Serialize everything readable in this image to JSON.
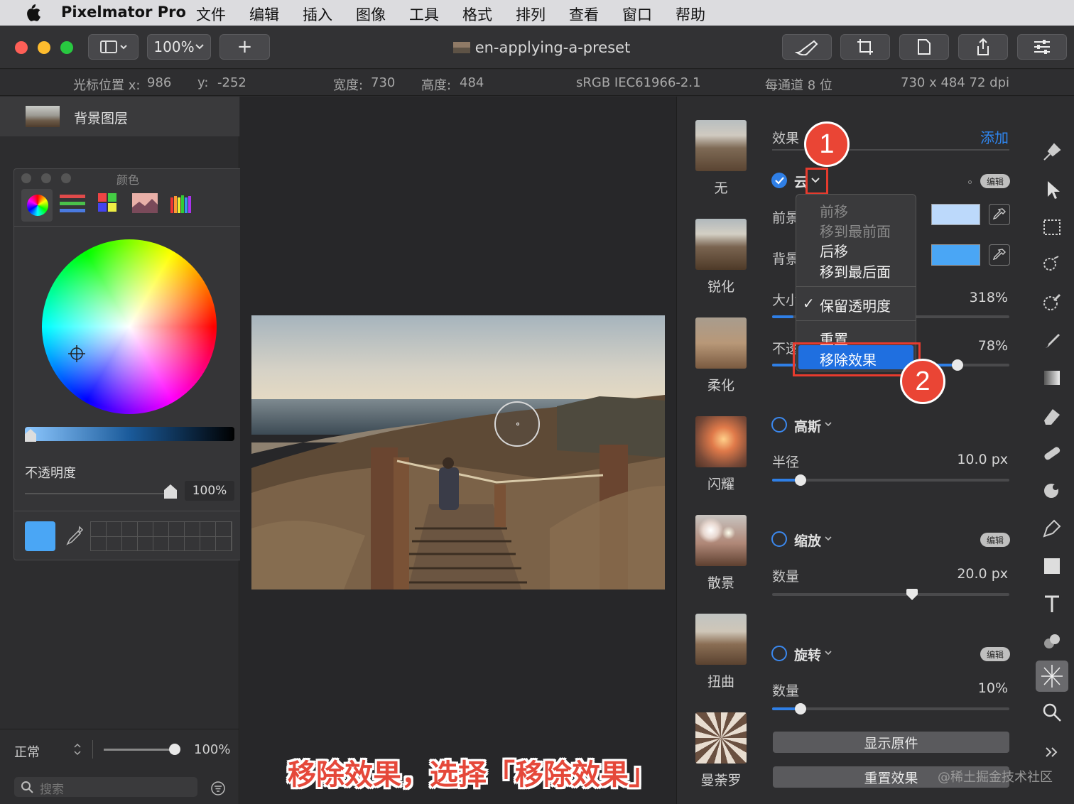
{
  "menubar": {
    "app_name": "Pixelmator Pro",
    "items": [
      "文件",
      "编辑",
      "插入",
      "图像",
      "工具",
      "格式",
      "排列",
      "查看",
      "窗口",
      "帮助"
    ]
  },
  "toolbar": {
    "zoom": "100%",
    "add_label": "+",
    "window_title": "en-applying-a-preset"
  },
  "infobar": {
    "cursor_x_label": "光标位置 x:",
    "cursor_x": "986",
    "cursor_y_label": "y:",
    "cursor_y": "-252",
    "width_label": "宽度:",
    "width": "730",
    "height_label": "高度:",
    "height": "484",
    "color_profile": "sRGB IEC61966-2.1",
    "bit_depth": "每通道 8 位",
    "dimensions": "730 x 484 72 dpi"
  },
  "layers": {
    "background_layer": "背景图层",
    "blend_mode": "正常",
    "opacity": "100%",
    "opacity_fraction": 1.0,
    "search_placeholder": "搜索"
  },
  "color_window": {
    "title": "颜色",
    "opacity_label": "不透明度",
    "opacity_value": "100%",
    "opacity_fraction": 1.0,
    "swatch_color": "#4aa6f5"
  },
  "presets": [
    {
      "label": "无"
    },
    {
      "label": "锐化"
    },
    {
      "label": "柔化"
    },
    {
      "label": "闪耀"
    },
    {
      "label": "散景"
    },
    {
      "label": "扭曲"
    },
    {
      "label": "曼荼罗"
    }
  ],
  "effects": {
    "header": "效果",
    "add": "添加",
    "edit_badge": "编辑",
    "cloud_effect": {
      "name": "云",
      "fg_label": "前景",
      "bg_label": "背景",
      "size_label": "大小",
      "size_value": "318%",
      "opacity_label": "不透",
      "opacity_value": "78%",
      "opacity_fraction": 0.78,
      "fg_color": "#bcd9fb",
      "bg_color": "#4aa6f5"
    },
    "gaussian": {
      "name": "高斯",
      "radius_label": "半径",
      "radius_value": "10.0 px",
      "fraction": 0.12
    },
    "zoom": {
      "name": "缩放",
      "amount_label": "数量",
      "amount_value": "20.0 px",
      "fraction": 0.59
    },
    "twirl": {
      "name": "旋转",
      "amount_label": "数量",
      "amount_value": "10%",
      "fraction": 0.12
    },
    "show_original": "显示原件",
    "reset_effects": "重置效果"
  },
  "context_menu": {
    "items": [
      "前移",
      "移到最前面",
      "后移",
      "移到最后面",
      "保留透明度",
      "重置",
      "移除效果"
    ],
    "checkmark": "✓"
  },
  "annotations": {
    "callout_1": "1",
    "callout_2": "2",
    "caption": "移除效果，选择「移除效果」",
    "watermark": "@稀土掘金技术社区"
  }
}
